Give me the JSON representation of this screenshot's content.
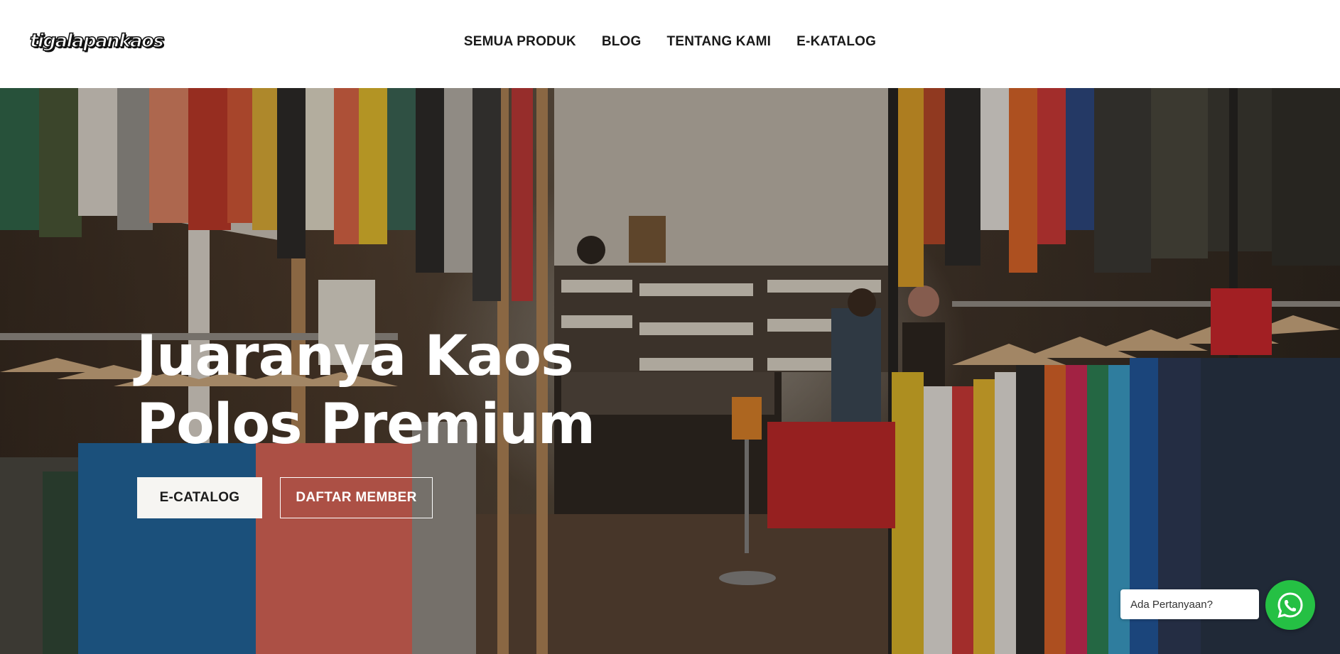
{
  "header": {
    "logo_text": "tigalapankaos",
    "nav": [
      {
        "label": "SEMUA PRODUK"
      },
      {
        "label": "BLOG"
      },
      {
        "label": "TENTANG KAMI"
      },
      {
        "label": "E-KATALOG"
      }
    ]
  },
  "hero": {
    "headline_line1": "Juaranya Kaos",
    "headline_line2": "Polos Premium",
    "primary_button": "E-CATALOG",
    "secondary_button": "DAFTAR MEMBER",
    "background": "clothing store interior photo"
  },
  "whatsapp": {
    "bubble_text": "Ada Pertanyaan?",
    "icon": "whatsapp-icon",
    "color": "#25c044"
  }
}
